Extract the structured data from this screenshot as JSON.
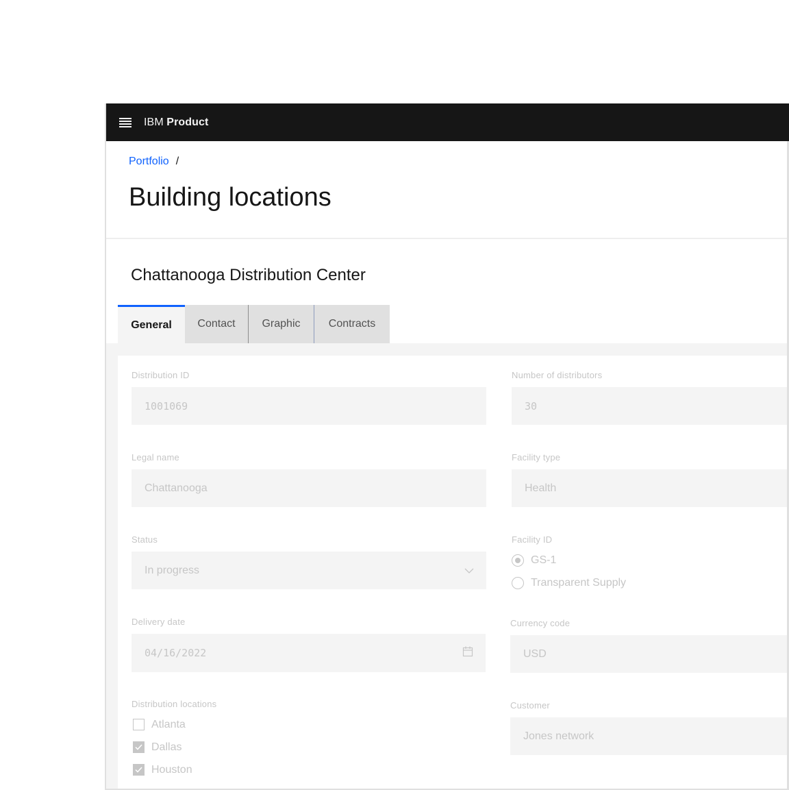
{
  "header": {
    "menu_icon": "hamburger-menu-icon",
    "brand_prefix": "IBM",
    "brand_name": "Product"
  },
  "breadcrumb": {
    "items": [
      {
        "label": "Portfolio"
      }
    ],
    "separator": "/"
  },
  "page": {
    "title": "Building locations",
    "section_title": "Chattanooga Distribution Center"
  },
  "tabs": [
    {
      "label": "General",
      "active": true
    },
    {
      "label": "Contact",
      "active": false
    },
    {
      "label": "Graphic",
      "active": false
    },
    {
      "label": "Contracts",
      "active": false
    }
  ],
  "form": {
    "distribution_id": {
      "label": "Distribution ID",
      "value": "1001069"
    },
    "number_of_distributors": {
      "label": "Number of distributors",
      "value": "30"
    },
    "legal_name": {
      "label": "Legal name",
      "value": "Chattanooga"
    },
    "facility_type": {
      "label": "Facility type",
      "value": "Health"
    },
    "status": {
      "label": "Status",
      "value": "In progress",
      "icon": "chevron-down-icon"
    },
    "facility_id": {
      "label": "Facility ID",
      "options": [
        {
          "label": "GS-1",
          "selected": true
        },
        {
          "label": "Transparent Supply",
          "selected": false
        }
      ]
    },
    "delivery_date": {
      "label": "Delivery date",
      "value": "04/16/2022",
      "icon": "calendar-icon"
    },
    "currency_code": {
      "label": "Currency code",
      "value": "USD"
    },
    "distribution_locations": {
      "label": "Distribution locations",
      "options": [
        {
          "label": "Atlanta",
          "checked": false
        },
        {
          "label": "Dallas",
          "checked": true
        },
        {
          "label": "Houston",
          "checked": true
        }
      ]
    },
    "customer": {
      "label": "Customer",
      "value": "Jones network"
    },
    "disabled": true
  },
  "colors": {
    "header_bg": "#161616",
    "link": "#0f62fe",
    "active_tab_indicator": "#0f62fe",
    "disabled_text": "#c6c6c6",
    "field_bg": "#f4f4f4"
  }
}
